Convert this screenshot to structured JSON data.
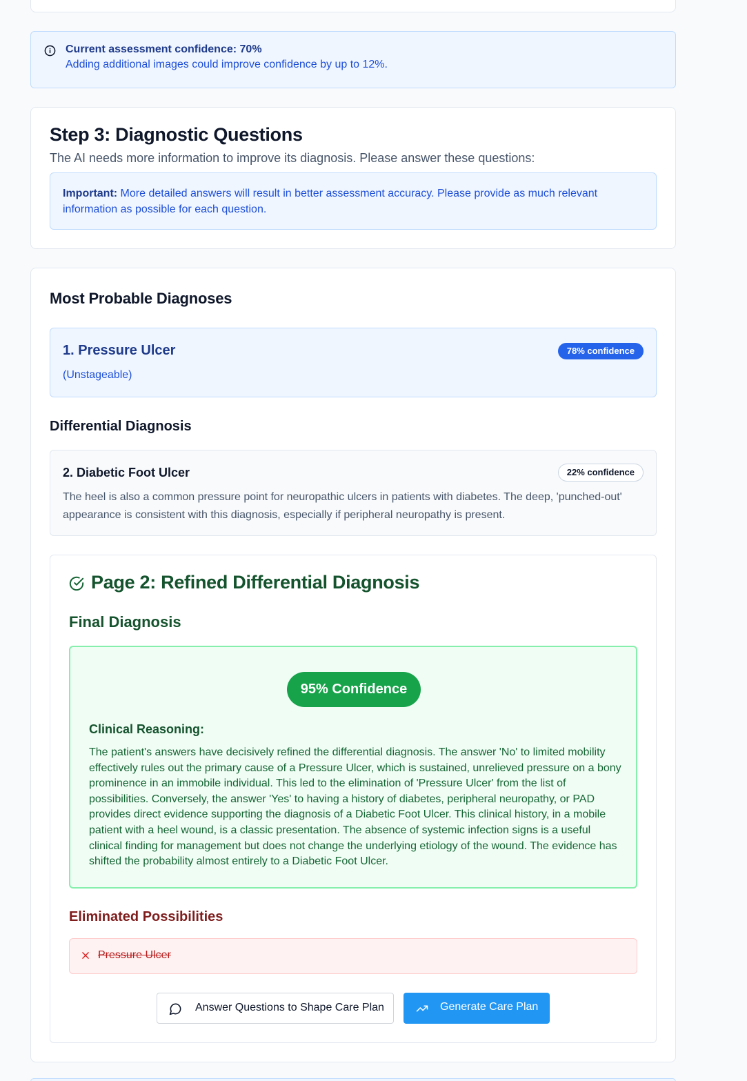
{
  "banner": {
    "title": "Current assessment confidence: 70%",
    "subtitle": "Adding additional images could improve confidence by up to 12%.",
    "icon": "info-icon"
  },
  "step": {
    "title": "Step 3: Diagnostic Questions",
    "subtitle": "The AI needs more information to improve its diagnosis. Please answer these questions:",
    "important_label": "Important:",
    "important_text": " More detailed answers will result in better assessment accuracy. Please provide as much relevant information as possible for each question."
  },
  "diagnoses": {
    "heading": "Most Probable Diagnoses",
    "primary": {
      "name": "1. Pressure Ulcer",
      "detail": "(Unstageable)",
      "confidence": "78% confidence"
    },
    "differential_heading": "Differential Diagnosis",
    "differential": [
      {
        "name": "2. Diabetic Foot Ulcer",
        "confidence": "22% confidence",
        "description": "The heel is also a common pressure point for neuropathic ulcers in patients with diabetes. The deep, 'punched-out' appearance is consistent with this diagnosis, especially if peripheral neuropathy is present."
      }
    ]
  },
  "refined": {
    "title": "Page 2: Refined Differential Diagnosis",
    "icon": "check-circle-icon",
    "final_heading": "Final Diagnosis",
    "confidence": "95% Confidence",
    "reasoning_label": "Clinical Reasoning:",
    "reasoning_text": "The patient's answers have decisively refined the differential diagnosis. The answer 'No' to limited mobility effectively rules out the primary cause of a Pressure Ulcer, which is sustained, unrelieved pressure on a bony prominence in an immobile individual. This led to the elimination of 'Pressure Ulcer' from the list of possibilities. Conversely, the answer 'Yes' to having a history of diabetes, peripheral neuropathy, or PAD provides direct evidence supporting the diagnosis of a Diabetic Foot Ulcer. This clinical history, in a mobile patient with a heel wound, is a classic presentation. The absence of systemic infection signs is a useful clinical finding for management but does not change the underlying etiology of the wound. The evidence has shifted the probability almost entirely to a Diabetic Foot Ulcer.",
    "eliminated_heading": "Eliminated Possibilities",
    "eliminated": [
      "Pressure Ulcer"
    ]
  },
  "actions": {
    "answer_questions": "Answer Questions to Shape Care Plan",
    "generate_plan": "Generate Care Plan"
  },
  "colors": {
    "primary_blue": "#2563eb",
    "button_blue": "#2196f3",
    "success_green": "#16a34a",
    "danger_red": "#b91c1c"
  }
}
